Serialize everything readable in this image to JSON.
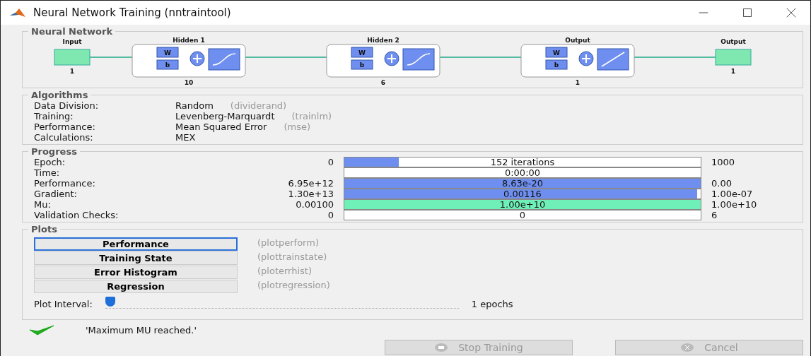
{
  "window": {
    "title": "Neural Network Training (nntraintool)"
  },
  "network": {
    "title": "Neural Network",
    "input": {
      "label": "Input",
      "size": "1"
    },
    "layers": [
      {
        "title": "Hidden 1",
        "weight": "W",
        "bias": "b",
        "size": "10",
        "kind": "sigmoid"
      },
      {
        "title": "Hidden 2",
        "weight": "W",
        "bias": "b",
        "size": "6",
        "kind": "sigmoid"
      },
      {
        "title": "Output",
        "weight": "W",
        "bias": "b",
        "size": "1",
        "kind": "linear"
      }
    ],
    "output": {
      "label": "Output",
      "size": "1"
    }
  },
  "algorithms": {
    "title": "Algorithms",
    "rows": [
      {
        "label": "Data Division:",
        "value": "Random",
        "function": "(dividerand)"
      },
      {
        "label": "Training:",
        "value": "Levenberg-Marquardt",
        "function": "(trainlm)"
      },
      {
        "label": "Performance:",
        "value": "Mean Squared Error",
        "function": "(mse)"
      },
      {
        "label": "Calculations:",
        "value": "MEX"
      }
    ]
  },
  "progress": {
    "title": "Progress",
    "rows": [
      {
        "label": "Epoch:",
        "start": "0",
        "current": "152 iterations",
        "end": "1000",
        "level": 0.152,
        "kind": "blue"
      },
      {
        "label": "Time:",
        "current": "0:00:00",
        "level": 0,
        "kind": "blue"
      },
      {
        "label": "Performance:",
        "start": "6.95e+12",
        "current": "8.63e-20",
        "end": "0.00",
        "level": 1,
        "kind": "blue"
      },
      {
        "label": "Gradient:",
        "start": "1.30e+13",
        "current": "0.00116",
        "end": "1.00e-07",
        "level": 0.99,
        "kind": "blue"
      },
      {
        "label": "Mu:",
        "start": "0.00100",
        "current": "1.00e+10",
        "end": "1.00e+10",
        "level": 1,
        "kind": "green"
      },
      {
        "label": "Validation Checks:",
        "start": "0",
        "current": "0",
        "end": "6",
        "level": 0,
        "kind": "blue"
      }
    ]
  },
  "plots": {
    "title": "Plots",
    "buttons": [
      {
        "label": "Performance",
        "function": "(plotperform)",
        "focused": true
      },
      {
        "label": "Training State",
        "function": "(plottrainstate)",
        "focused": false
      },
      {
        "label": "Error Histogram",
        "function": "(ploterrhist)",
        "focused": false
      },
      {
        "label": "Regression",
        "function": "(plotregression)",
        "focused": false
      }
    ],
    "interval": {
      "label": "Plot Interval:",
      "level": 0,
      "reading": "1 epochs"
    }
  },
  "status": {
    "message": "'Maximum MU reached.'",
    "success": true
  },
  "buttons": [
    {
      "label": "Stop Training",
      "disabled": true,
      "kind": "stop"
    },
    {
      "label": "Cancel",
      "disabled": true,
      "kind": "cancel"
    }
  ]
}
